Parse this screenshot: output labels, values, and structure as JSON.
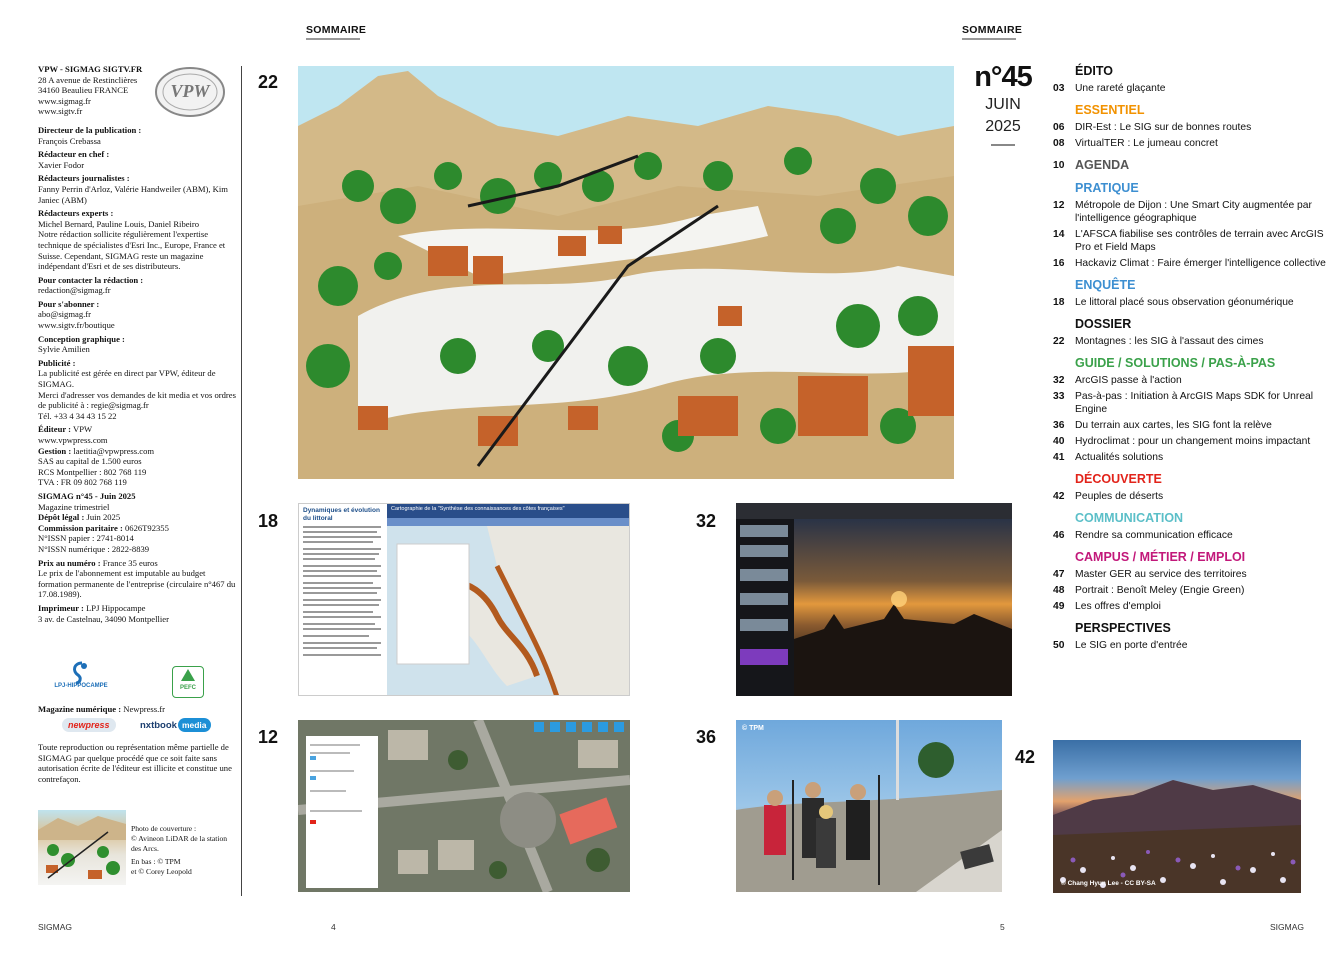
{
  "header": {
    "left": "SOMMAIRE",
    "right": "SOMMAIRE"
  },
  "colophon": {
    "publisher": "VPW - SIGMAG SIGTV.FR",
    "address1": "28 A avenue de Restinclières",
    "address2": "34160 Beaulieu FRANCE",
    "web1": "www.sigmag.fr",
    "web2": "www.sigtv.fr",
    "logo_text": "VPW",
    "dir_label": "Directeur de la publication :",
    "dir_value": "François Crebassa",
    "chief_label": "Rédacteur en chef :",
    "chief_value": "Xavier Fodor",
    "journalists_label": "Rédacteurs journalistes :",
    "journalists_value": "Fanny Perrin d'Arloz, Valérie Handweiler (ABM), Kim Janiec (ABM)",
    "experts_label": "Rédacteurs experts :",
    "experts_value": "Michel Bernard, Pauline Louis, Daniel Ribeiro",
    "notice": "Notre rédaction sollicite régulièrement l'expertise technique de spécialistes d'Esri Inc., Europe, France et Suisse. Cependant, SIGMAG reste un magazine indépendant d'Esri et de ses distributeurs.",
    "contact_label": "Pour contacter la rédaction :",
    "contact_value": "redaction@sigmag.fr",
    "subscribe_label": "Pour s'abonner :",
    "subscribe_email": "abo@sigmag.fr",
    "subscribe_web": "www.sigtv.fr/boutique",
    "design_label": "Conception graphique :",
    "design_value": "Sylvie Amilien",
    "ads_label": "Publicité :",
    "ads_value": "La publicité est gérée en direct par VPW, éditeur de SIGMAG.",
    "ads_value2": "Merci d'adresser vos demandes de kit media et vos ordres de publicité à : regie@sigmag.fr",
    "ads_tel": "Tél. +33 4 34 43 15 22",
    "editor_label": "Éditeur :",
    "editor_value": "VPW",
    "editor_web": "www.vpwpress.com",
    "mgmt_label": "Gestion :",
    "mgmt_value": "laetitia@vpwpress.com",
    "capital": "SAS au capital de 1.500 euros",
    "rcs": "RCS Montpellier : 802 768 119",
    "tva": "TVA : FR 09 802 768 119",
    "issue_label": "SIGMAG n°45 - Juin 2025",
    "issue_type": "Magazine trimestriel",
    "legal_label": "Dépôt légal :",
    "legal_value": "Juin 2025",
    "commission_label": "Commission paritaire :",
    "commission_value": "0626T92355",
    "issn_paper": "N°ISSN papier : 2741-8014",
    "issn_digital": "N°ISSN numérique : 2822-8839",
    "price_label": "Prix au numéro :",
    "price_value": "France 35 euros",
    "price_notice": "Le prix de l'abonnement est imputable au budget formation permanente de l'entreprise (circulaire n°467 du 17.08.1989).",
    "printer_label": "Imprimeur :",
    "printer_value": "LPJ Hippocampe",
    "printer_address": "3 av. de Castelnau, 34090 Montpellier",
    "hippo_logo": "LPJ-HIPPOCAMPE",
    "pefc_logo": "PEFC",
    "digital_label": "Magazine numérique :",
    "digital_value": "Newpress.fr",
    "newpress_logo": "newpress",
    "nxtbook_logo": "nxtbook",
    "nxtbook_logo2": "media",
    "copyright": "Toute reproduction ou représentation même partielle de SIGMAG par quelque procédé que ce soit faite sans autorisation écrite de l'éditeur est illicite et constitue une contrefaçon.",
    "cover_caption1": "Photo de couverture :",
    "cover_caption2": "© Avineon LiDAR de la station des Arcs.",
    "cover_caption3": "En bas : © TPM",
    "cover_caption4": "et © Corey Leopold"
  },
  "issue": {
    "number": "n°45",
    "month": "JUIN",
    "year": "2025"
  },
  "pictures": {
    "p22": "22",
    "p18": "18",
    "p32": "32",
    "p12": "12",
    "p36": "36",
    "p42": "42",
    "shot18_title": "Dynamiques et évolution du littoral",
    "shot18_banner": "Cartographie de la \"Synthèse des connaissances des côtes françaises\"",
    "credit36": "© TPM",
    "credit42": "© Chang Hyun Lee - CC BY-SA"
  },
  "toc": [
    {
      "section": "ÉDITO",
      "color": "#111111",
      "items": [
        {
          "page": "03",
          "title": "Une rareté glaçante"
        }
      ]
    },
    {
      "section": "ESSENTIEL",
      "color": "#f29200",
      "items": [
        {
          "page": "06",
          "title": "DIR-Est : Le SIG sur de bonnes routes"
        },
        {
          "page": "08",
          "title": "VirtualTER : Le jumeau concret"
        }
      ]
    },
    {
      "section": "AGENDA",
      "color": "#555555",
      "inline_page": "10"
    },
    {
      "section": "PRATIQUE",
      "color": "#3d8fd1",
      "items": [
        {
          "page": "12",
          "title": "Métropole de Dijon : Une Smart City augmentée par l'intelligence géographique"
        },
        {
          "page": "14",
          "title": "L'AFSCA fiabilise ses contrôles de terrain avec ArcGIS Pro et Field Maps"
        },
        {
          "page": "16",
          "title": "Hackaviz Climat : Faire émerger l'intelligence collective"
        }
      ]
    },
    {
      "section": "ENQUÊTE",
      "color": "#3d8fd1",
      "items": [
        {
          "page": "18",
          "title": "Le littoral placé sous observation géonumérique"
        }
      ]
    },
    {
      "section": "DOSSIER",
      "color": "#111111",
      "items": [
        {
          "page": "22",
          "title": "Montagnes : les SIG à l'assaut des cimes"
        }
      ]
    },
    {
      "section": "GUIDE / SOLUTIONS / PAS-À-PAS",
      "color": "#3aa14a",
      "items": [
        {
          "page": "32",
          "title": "ArcGIS passe à l'action"
        },
        {
          "page": "33",
          "title": "Pas-à-pas : Initiation à ArcGIS Maps SDK for Unreal Engine"
        },
        {
          "page": "36",
          "title": "Du terrain aux cartes, les SIG font la relève"
        },
        {
          "page": "40",
          "title": "Hydroclimat : pour un changement moins impactant"
        },
        {
          "page": "41",
          "title": "Actualités solutions"
        }
      ]
    },
    {
      "section": "DÉCOUVERTE",
      "color": "#e2231a",
      "items": [
        {
          "page": "42",
          "title": "Peuples de déserts"
        }
      ]
    },
    {
      "section": "COMMUNICATION",
      "color": "#5bbfc8",
      "items": [
        {
          "page": "46",
          "title": "Rendre sa communication efficace"
        }
      ]
    },
    {
      "section": "CAMPUS / MÉTIER / EMPLOI",
      "color": "#c2187a",
      "items": [
        {
          "page": "47",
          "title": "Master GER au service des territoires"
        },
        {
          "page": "48",
          "title": "Portrait : Benoît Meley (Engie Green)"
        },
        {
          "page": "49",
          "title": "Les offres d'emploi"
        }
      ]
    },
    {
      "section": "PERSPECTIVES",
      "color": "#111111",
      "items": [
        {
          "page": "50",
          "title": "Le SIG en porte d'entrée"
        }
      ]
    }
  ],
  "footer": {
    "left_brand": "SIGMAG",
    "left_page": "4",
    "right_page": "5",
    "right_brand": "SIGMAG"
  }
}
